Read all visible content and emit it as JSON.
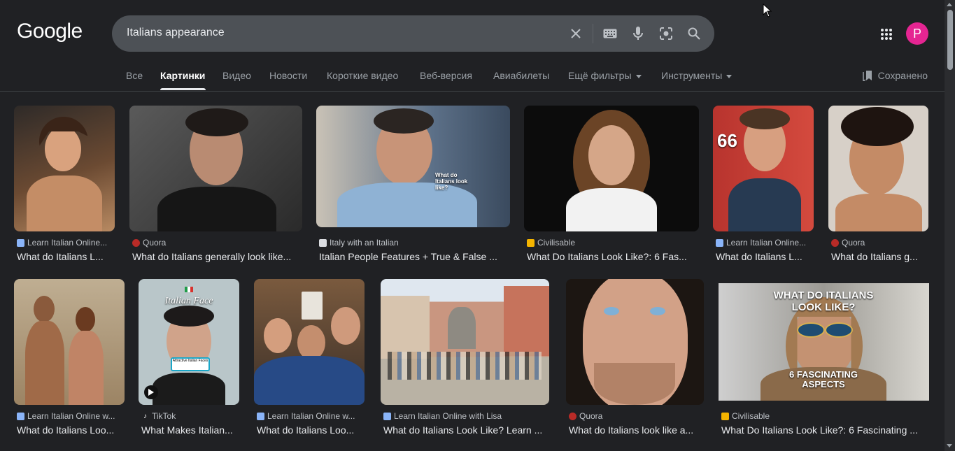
{
  "header": {
    "logo": "Google",
    "search": {
      "value": "Italians appearance"
    },
    "avatar_letter": "P"
  },
  "tabs": [
    {
      "label": "Все"
    },
    {
      "label": "Картинки"
    },
    {
      "label": "Видео"
    },
    {
      "label": "Новости"
    },
    {
      "label": "Короткие видео"
    },
    {
      "label": "Веб-версия"
    },
    {
      "label": "Авиабилеты"
    },
    {
      "label": "Ещё фильтры"
    },
    {
      "label": "Инструменты"
    }
  ],
  "saved_label": "Сохранено",
  "results": [
    {
      "source": "Learn Italian Online...",
      "title": "What do Italians L...",
      "favicon": "#8ab4f8"
    },
    {
      "source": "Quora",
      "title": "What do Italians generally look like...",
      "favicon": "#b92b27"
    },
    {
      "source": "Italy with an Italian",
      "title": "Italian People Features + True & False ...",
      "favicon": "#dadce0"
    },
    {
      "source": "Civilisable",
      "title": "What Do Italians Look Like?: 6 Fas...",
      "favicon": "#f4b400"
    },
    {
      "source": "Learn Italian Online...",
      "title": "What do Italians L...",
      "favicon": "#8ab4f8"
    },
    {
      "source": "Quora",
      "title": "What do Italians g...",
      "favicon": "#b92b27"
    },
    {
      "source": "Learn Italian Online w...",
      "title": "What do Italians Loo...",
      "favicon": "#8ab4f8"
    },
    {
      "source": "TikTok",
      "title": "What Makes Italian...",
      "favicon": "#ffffff",
      "overlay": "Italian Face",
      "caption": "Attractive Italian Faces"
    },
    {
      "source": "Learn Italian Online w...",
      "title": "What do Italians Loo...",
      "favicon": "#8ab4f8"
    },
    {
      "source": "Learn Italian Online with Lisa",
      "title": "What do Italians Look Like? Learn ...",
      "favicon": "#8ab4f8"
    },
    {
      "source": "Quora",
      "title": "What do Italians look like a...",
      "favicon": "#b92b27"
    },
    {
      "source": "Civilisable",
      "title": "What Do Italians Look Like?: 6 Fascinating ...",
      "favicon": "#f4b400",
      "overlay": "WHAT DO ITALIANS LOOK LIKE?",
      "caption": "6 FASCINATING ASPECTS"
    }
  ],
  "row1_overlay": {
    "card3": "What do Italians look like?",
    "card5": "66"
  },
  "colors": {
    "background": "#202124",
    "searchbox": "#4d5156",
    "avatar": "#e52592"
  }
}
